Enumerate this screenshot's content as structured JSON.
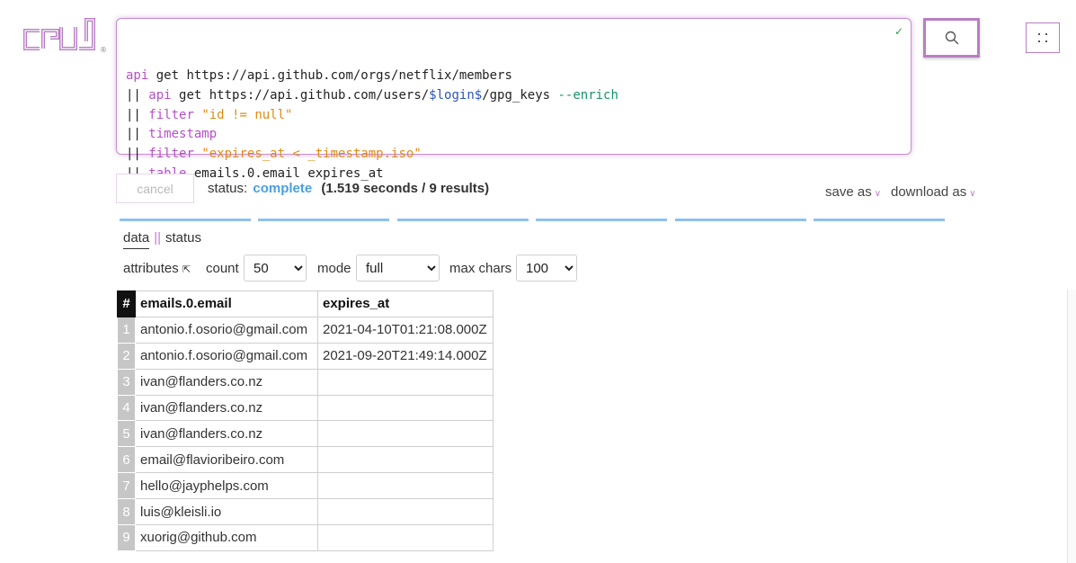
{
  "brand": {
    "logo_text": "crul",
    "registered_mark": "®",
    "accent_color": "#b97dc4"
  },
  "query": {
    "lines": [
      [
        {
          "t": "api",
          "k": "cmd"
        },
        {
          "t": " get https://api.github.com/orgs/netflix/members",
          "k": "plain"
        }
      ],
      [
        {
          "t": "|| ",
          "k": "pipe"
        },
        {
          "t": "api",
          "k": "cmd"
        },
        {
          "t": " get https://api.github.com/users/",
          "k": "plain"
        },
        {
          "t": "$login$",
          "k": "var"
        },
        {
          "t": "/gpg_keys ",
          "k": "plain"
        },
        {
          "t": "--enrich",
          "k": "flag"
        }
      ],
      [
        {
          "t": "|| ",
          "k": "pipe"
        },
        {
          "t": "filter",
          "k": "cmd"
        },
        {
          "t": " ",
          "k": "plain"
        },
        {
          "t": "\"id != null\"",
          "k": "str"
        }
      ],
      [
        {
          "t": "|| ",
          "k": "pipe"
        },
        {
          "t": "timestamp",
          "k": "cmd"
        }
      ],
      [
        {
          "t": "|| ",
          "k": "pipe"
        },
        {
          "t": "filter",
          "k": "cmd"
        },
        {
          "t": " ",
          "k": "plain"
        },
        {
          "t": "\"expires_at < _timestamp.iso\"",
          "k": "str"
        }
      ],
      [
        {
          "t": "|| ",
          "k": "pipe"
        },
        {
          "t": "table",
          "k": "cmd"
        },
        {
          "t": " emails.0.email expires_at",
          "k": "plain"
        }
      ]
    ],
    "valid_mark": "✓"
  },
  "toolbar": {
    "search_icon": "search-icon",
    "menu_icon": "grid-dots-icon",
    "cancel_label": "cancel",
    "status_label": "status:",
    "status_value": "complete",
    "status_detail": "(1.519 seconds / 9 results)",
    "save_as_label": "save as",
    "download_as_label": "download as",
    "status_color": "#4a9fe0"
  },
  "progress": {
    "segments": 6,
    "complete": 6,
    "color": "#8fc0ee"
  },
  "view_tabs": {
    "data_label": "data",
    "separator": "||",
    "status_label": "status"
  },
  "controls": {
    "attributes_label": "attributes",
    "attributes_icon": "collapse-arrow-icon",
    "count_label": "count",
    "count_value": "50",
    "mode_label": "mode",
    "mode_value": "full",
    "max_chars_label": "max chars",
    "max_chars_value": "100"
  },
  "table": {
    "index_header": "#",
    "columns": [
      "emails.0.email",
      "expires_at"
    ],
    "rows": [
      {
        "i": "1",
        "email": "antonio.f.osorio@gmail.com",
        "expires_at": "2021-04-10T01:21:08.000Z"
      },
      {
        "i": "2",
        "email": "antonio.f.osorio@gmail.com",
        "expires_at": "2021-09-20T21:49:14.000Z"
      },
      {
        "i": "3",
        "email": "ivan@flanders.co.nz",
        "expires_at": ""
      },
      {
        "i": "4",
        "email": "ivan@flanders.co.nz",
        "expires_at": ""
      },
      {
        "i": "5",
        "email": "ivan@flanders.co.nz",
        "expires_at": ""
      },
      {
        "i": "6",
        "email": "email@flavioribeiro.com",
        "expires_at": ""
      },
      {
        "i": "7",
        "email": "hello@jayphelps.com",
        "expires_at": ""
      },
      {
        "i": "8",
        "email": "luis@kleisli.io",
        "expires_at": ""
      },
      {
        "i": "9",
        "email": "xuorig@github.com",
        "expires_at": ""
      }
    ]
  }
}
